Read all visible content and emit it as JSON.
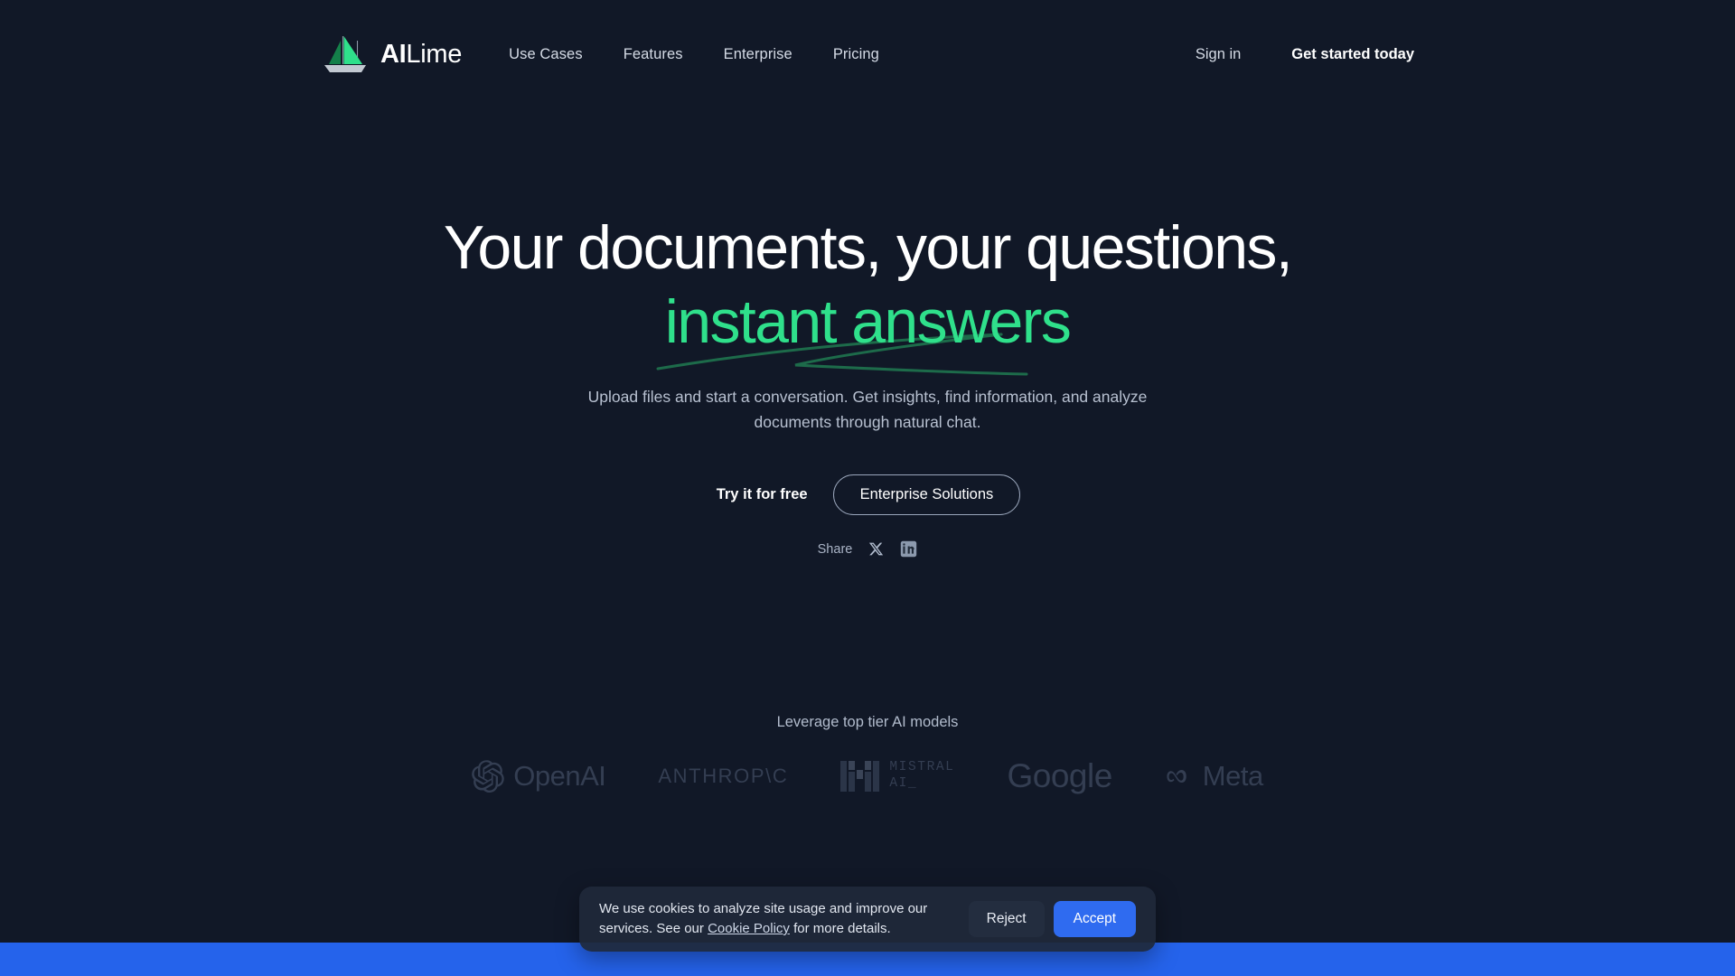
{
  "brand": {
    "name_bold": "AI",
    "name_light": "Lime",
    "logo_icon": "sailboat-logo",
    "sail_color": "#2fe08b",
    "sail_dark_color": "#14804a",
    "hull_color": "#c3c9d2"
  },
  "nav": {
    "items": [
      {
        "label": "Use Cases"
      },
      {
        "label": "Features"
      },
      {
        "label": "Enterprise"
      },
      {
        "label": "Pricing"
      }
    ],
    "sign_in": "Sign in",
    "get_started": "Get started today"
  },
  "hero": {
    "headline_line1": "Your documents, your questions,",
    "headline_accent": "instant answers",
    "accent_color": "#2fe08b",
    "underline_color": "#1d6b4a",
    "subtitle": "Upload files and start a conversation. Get insights, find information, and analyze documents through natural chat.",
    "cta_primary": "Try it for free",
    "cta_secondary": "Enterprise Solutions"
  },
  "share": {
    "label": "Share",
    "twitter_icon": "x-twitter-icon",
    "linkedin_icon": "linkedin-icon"
  },
  "logos": {
    "title": "Leverage top tier AI models",
    "items": [
      {
        "name": "OpenAI",
        "icon": "openai-icon"
      },
      {
        "name": "ANTHROP\\C",
        "icon": "anthropic-wordmark"
      },
      {
        "name": "MISTRAL\nAI_",
        "icon": "mistral-icon"
      },
      {
        "name": "Google",
        "icon": "google-wordmark"
      },
      {
        "name": "Meta",
        "icon": "meta-infinity-icon"
      }
    ]
  },
  "cookie": {
    "text_before_link": "We use cookies to analyze site usage and improve our services. See our ",
    "link_label": "Cookie Policy",
    "text_after_link": " for more details.",
    "reject_label": "Reject",
    "accept_label": "Accept",
    "accept_color": "#2f6bf0"
  },
  "page": {
    "background": "#111827",
    "bottom_band_color": "#2563eb"
  }
}
